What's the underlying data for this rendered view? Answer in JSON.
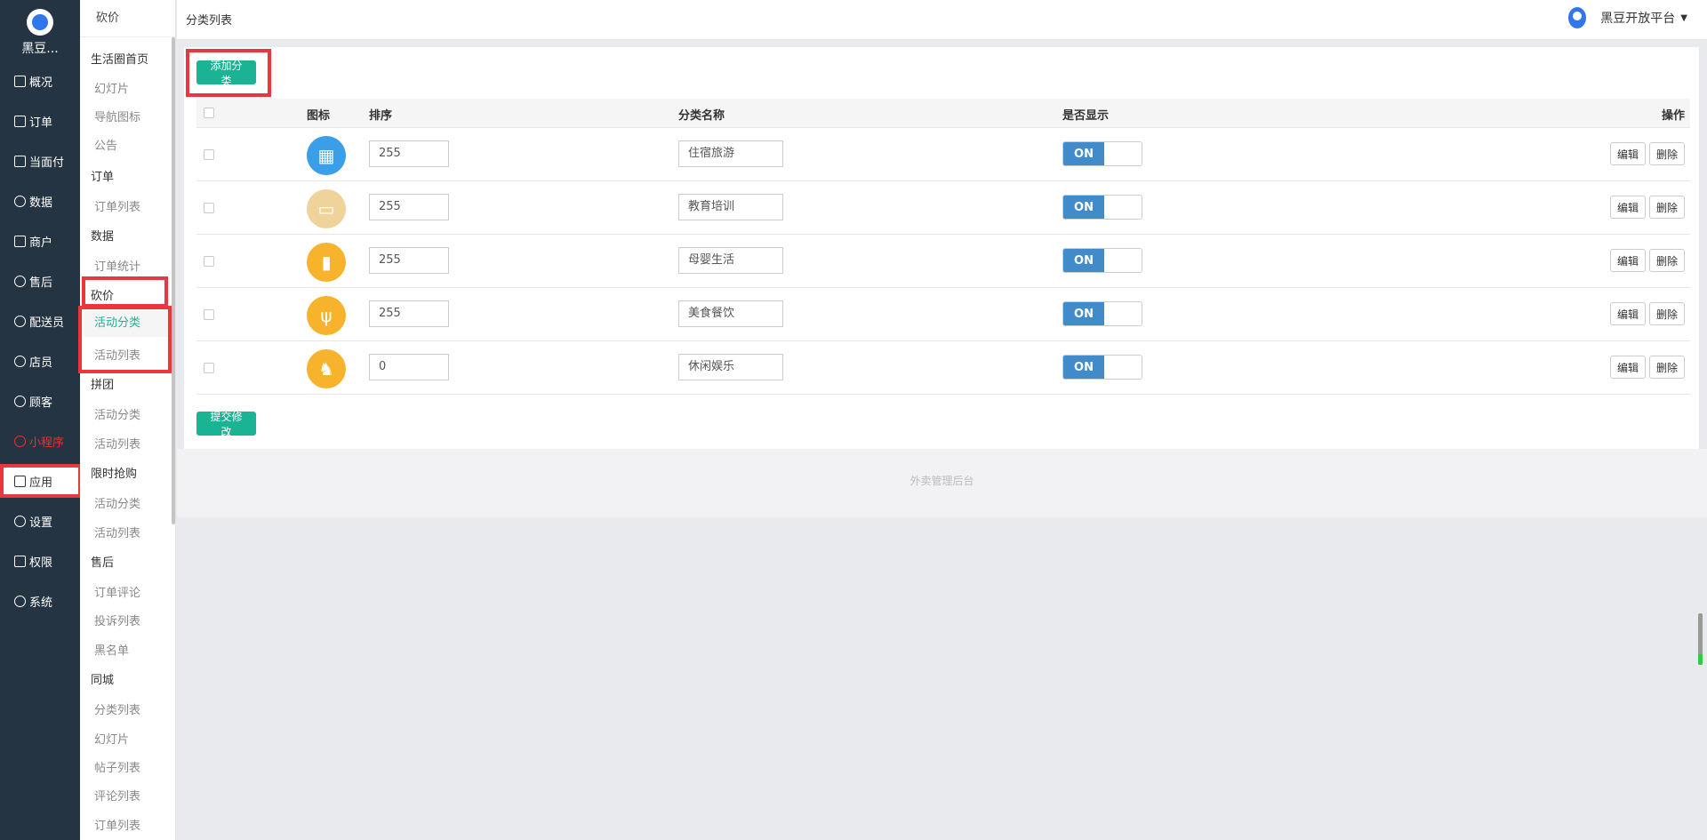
{
  "sidebar": {
    "logo_name": "黑豆...",
    "items": [
      {
        "label": "概况"
      },
      {
        "label": "订单"
      },
      {
        "label": "当面付"
      },
      {
        "label": "数据"
      },
      {
        "label": "商户"
      },
      {
        "label": "售后"
      },
      {
        "label": "配送员"
      },
      {
        "label": "店员"
      },
      {
        "label": "顾客"
      },
      {
        "label": "小程序"
      },
      {
        "label": "应用"
      },
      {
        "label": "设置"
      },
      {
        "label": "权限"
      },
      {
        "label": "系统"
      }
    ]
  },
  "subnav": {
    "title": "砍价",
    "entries": [
      {
        "label": "生活圈首页",
        "kind": "group"
      },
      {
        "label": "幻灯片",
        "kind": "sub"
      },
      {
        "label": "导航图标",
        "kind": "sub"
      },
      {
        "label": "公告",
        "kind": "sub"
      },
      {
        "label": "订单",
        "kind": "group"
      },
      {
        "label": "订单列表",
        "kind": "sub"
      },
      {
        "label": "数据",
        "kind": "group"
      },
      {
        "label": "订单统计",
        "kind": "sub"
      },
      {
        "label": "砍价",
        "kind": "group"
      },
      {
        "label": "活动分类",
        "kind": "sub",
        "active": true
      },
      {
        "label": "活动列表",
        "kind": "sub"
      },
      {
        "label": "拼团",
        "kind": "group"
      },
      {
        "label": "活动分类",
        "kind": "sub"
      },
      {
        "label": "活动列表",
        "kind": "sub"
      },
      {
        "label": "限时抢购",
        "kind": "group"
      },
      {
        "label": "活动分类",
        "kind": "sub"
      },
      {
        "label": "活动列表",
        "kind": "sub"
      },
      {
        "label": "售后",
        "kind": "group"
      },
      {
        "label": "订单评论",
        "kind": "sub"
      },
      {
        "label": "投诉列表",
        "kind": "sub"
      },
      {
        "label": "黑名单",
        "kind": "sub"
      },
      {
        "label": "同城",
        "kind": "group"
      },
      {
        "label": "分类列表",
        "kind": "sub"
      },
      {
        "label": "幻灯片",
        "kind": "sub"
      },
      {
        "label": "帖子列表",
        "kind": "sub"
      },
      {
        "label": "评论列表",
        "kind": "sub"
      },
      {
        "label": "订单列表",
        "kind": "sub"
      }
    ]
  },
  "header": {
    "breadcrumb": "分类列表",
    "platform": "黑豆开放平台"
  },
  "toolbar": {
    "add_label": "添加分类",
    "submit_label": "提交修改"
  },
  "table": {
    "columns": {
      "icon": "图标",
      "sort": "排序",
      "name": "分类名称",
      "show": "是否显示",
      "ops": "操作"
    },
    "rows": [
      {
        "icon": "building-icon",
        "color": "#3a9ee8",
        "sort": "255",
        "name": "住宿旅游",
        "show": "ON",
        "edit": "编辑",
        "delete": "删除"
      },
      {
        "icon": "book-icon",
        "color": "#f0d39a",
        "sort": "255",
        "name": "教育培训",
        "show": "ON",
        "edit": "编辑",
        "delete": "删除"
      },
      {
        "icon": "baby-bottle-icon",
        "color": "#f7b32b",
        "sort": "255",
        "name": "母婴生活",
        "show": "ON",
        "edit": "编辑",
        "delete": "删除"
      },
      {
        "icon": "fork-knife-icon",
        "color": "#f7b32b",
        "sort": "255",
        "name": "美食餐饮",
        "show": "ON",
        "edit": "编辑",
        "delete": "删除"
      },
      {
        "icon": "rocking-horse-icon",
        "color": "#f7b32b",
        "sort": "0",
        "name": "休闲娱乐",
        "show": "ON",
        "edit": "编辑",
        "delete": "删除"
      }
    ]
  },
  "footer": "外卖管理后台"
}
